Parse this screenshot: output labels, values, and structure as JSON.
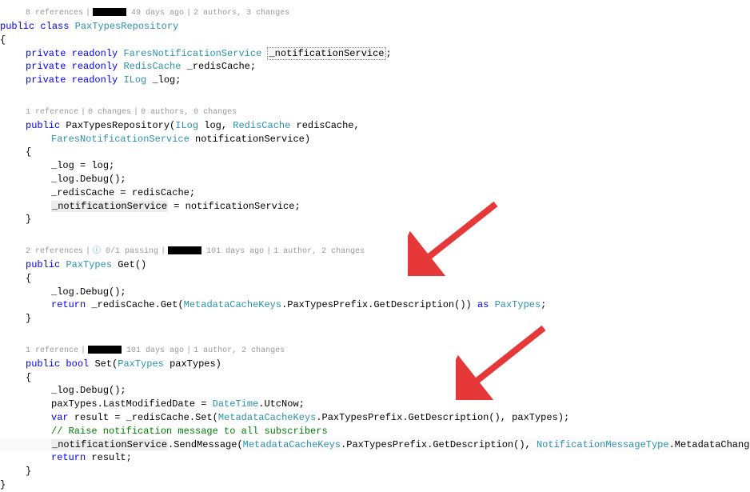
{
  "codelens": {
    "class": {
      "refs": "8 references",
      "time": "49 days ago",
      "authors": "2 authors, 3 changes"
    },
    "ctor": {
      "refs": "1 reference",
      "changes": "0 changes",
      "authors": "0 authors, 0 changes"
    },
    "get": {
      "refs": "2 references",
      "passing": "0/1 passing",
      "time": "101 days ago",
      "authors": "1 author, 2 changes"
    },
    "set": {
      "refs": "1 reference",
      "time": "101 days ago",
      "authors": "1 author, 2 changes"
    }
  },
  "kw": {
    "public": "public",
    "class": "class",
    "private": "private",
    "readonly": "readonly",
    "return": "return",
    "as": "as",
    "var": "var",
    "bool": "bool"
  },
  "type": {
    "PaxTypesRepository": "PaxTypesRepository",
    "FaresNotificationService": "FaresNotificationService",
    "RedisCache": "RedisCache",
    "ILog": "ILog",
    "PaxTypes": "PaxTypes",
    "MetadataCacheKeys": "MetadataCacheKeys",
    "DateTime": "DateTime",
    "NotificationMessageType": "NotificationMessageType"
  },
  "id": {
    "notificationService": "_notificationService",
    "redisCache": "_redisCache",
    "log": "_log",
    "logParam": "log",
    "redisCacheParam": "redisCache",
    "notificationServiceParam": "notificationService",
    "paxTypesParam": "paxTypes",
    "result": "result"
  },
  "member": {
    "Debug": "Debug",
    "Get": "Get",
    "Set": "Set",
    "PaxTypesPrefix": "PaxTypesPrefix",
    "GetDescription": "GetDescription",
    "LastModifiedDate": "LastModifiedDate",
    "UtcNow": "UtcNow",
    "SendMessage": "SendMessage",
    "MetadataChanged": "MetadataChanged"
  },
  "comment": {
    "raise": "// Raise notification message to all subscribers"
  }
}
